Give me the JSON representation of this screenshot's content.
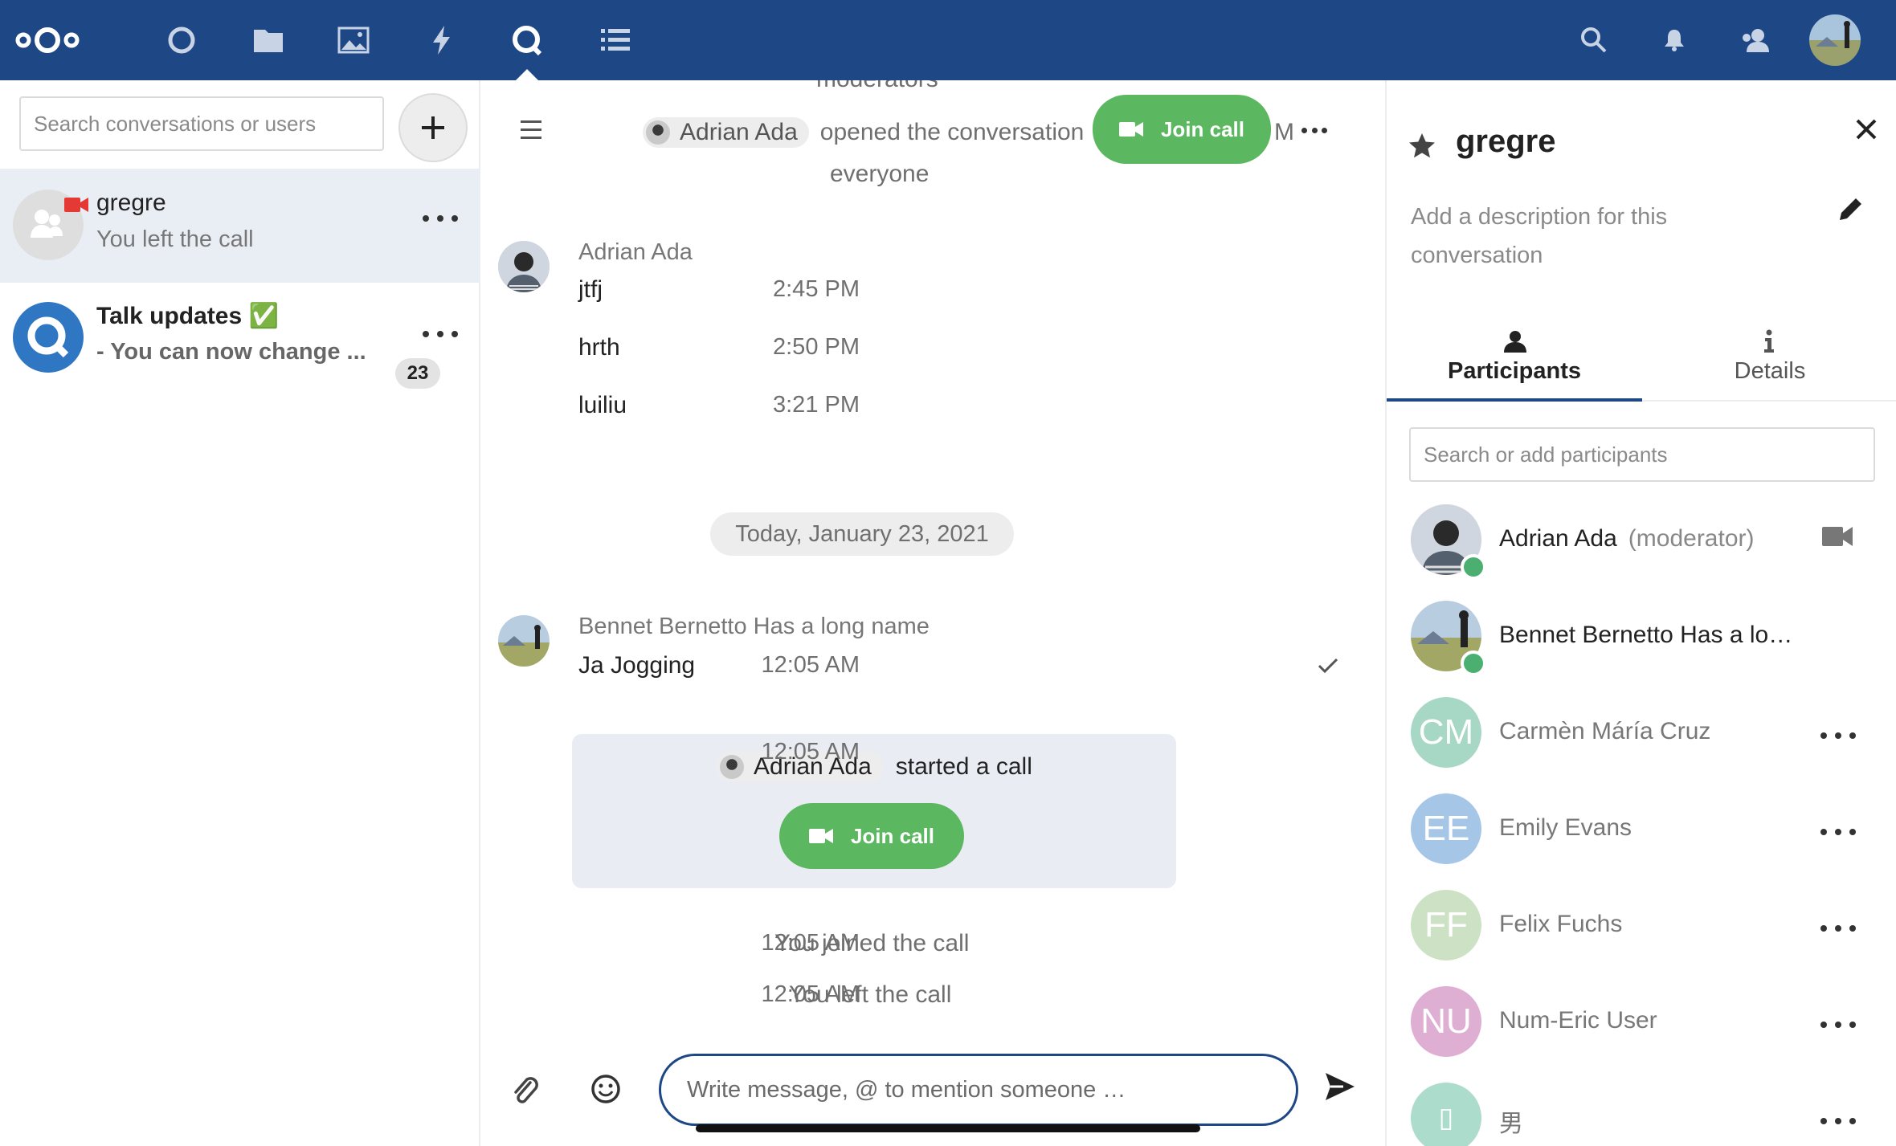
{
  "header": {
    "nav_icons": [
      "nextcloud-logo",
      "dashboard-icon",
      "files-icon",
      "photos-icon",
      "activity-icon",
      "talk-icon",
      "deck-icon"
    ],
    "right_icons": [
      "search-icon",
      "notifications-icon",
      "contacts-icon"
    ],
    "active_app": "talk"
  },
  "left": {
    "search_placeholder": "Search conversations or users",
    "conversations": [
      {
        "name": "gregre",
        "subtitle": "You left the call",
        "active": true,
        "in_call": true
      },
      {
        "name": "Talk updates ✅",
        "subtitle": "- You can now change ...",
        "unread": "23"
      }
    ]
  },
  "chat": {
    "top_cut_text": "moderators",
    "sys_opened": {
      "author": "Adrian Ada",
      "text": "opened the conversation",
      "cut": "M",
      "tail": "everyone"
    },
    "join_call_top": "Join call",
    "group1": {
      "author": "Adrian Ada",
      "messages": [
        {
          "text": "jtfj",
          "time": "2:45 PM"
        },
        {
          "text": "hrth",
          "time": "2:50 PM"
        },
        {
          "text": "luiliu",
          "time": "3:21 PM"
        }
      ]
    },
    "date_separator": "Today, January 23, 2021",
    "group2": {
      "author": "Bennet Bernetto Has a long name",
      "message": "Ja Jogging",
      "time": "12:05 AM"
    },
    "call_card": {
      "author": "Adrian Ada",
      "text": "started a call",
      "button": "Join call",
      "time": "12:05 AM"
    },
    "sys_joined": {
      "text": "You joined the call",
      "time": "12:05 AM"
    },
    "sys_left": {
      "text": "You left the call",
      "time": "12:05 AM"
    },
    "composer_placeholder": "Write message, @ to mention someone …"
  },
  "right": {
    "title": "gregre",
    "description_placeholder": "Add a description for this conversation",
    "tabs": [
      {
        "label": "Participants",
        "active": true
      },
      {
        "label": "Details"
      }
    ],
    "search_placeholder": "Search or add participants",
    "participants": [
      {
        "name": "Adrian Ada",
        "role": "(moderator)"
      },
      {
        "name": "Bennet Bernetto Has a lo…"
      },
      {
        "name": "Carmèn Máría Cruz",
        "initials": "CM",
        "color": "#9fd3bf"
      },
      {
        "name": "Emily Evans",
        "initials": "EE",
        "color": "#9ec2e6"
      },
      {
        "name": "Felix Fuchs",
        "initials": "FF",
        "color": "#c6dcb8"
      },
      {
        "name": "Num-Eric User",
        "initials": "NU",
        "color": "#dca7d0"
      },
      {
        "name": "男",
        "initials": "▯",
        "color": "#a9d9c7"
      }
    ]
  },
  "colors": {
    "brand": "#1e4785",
    "join": "#5cb860",
    "online": "#4caf72"
  }
}
